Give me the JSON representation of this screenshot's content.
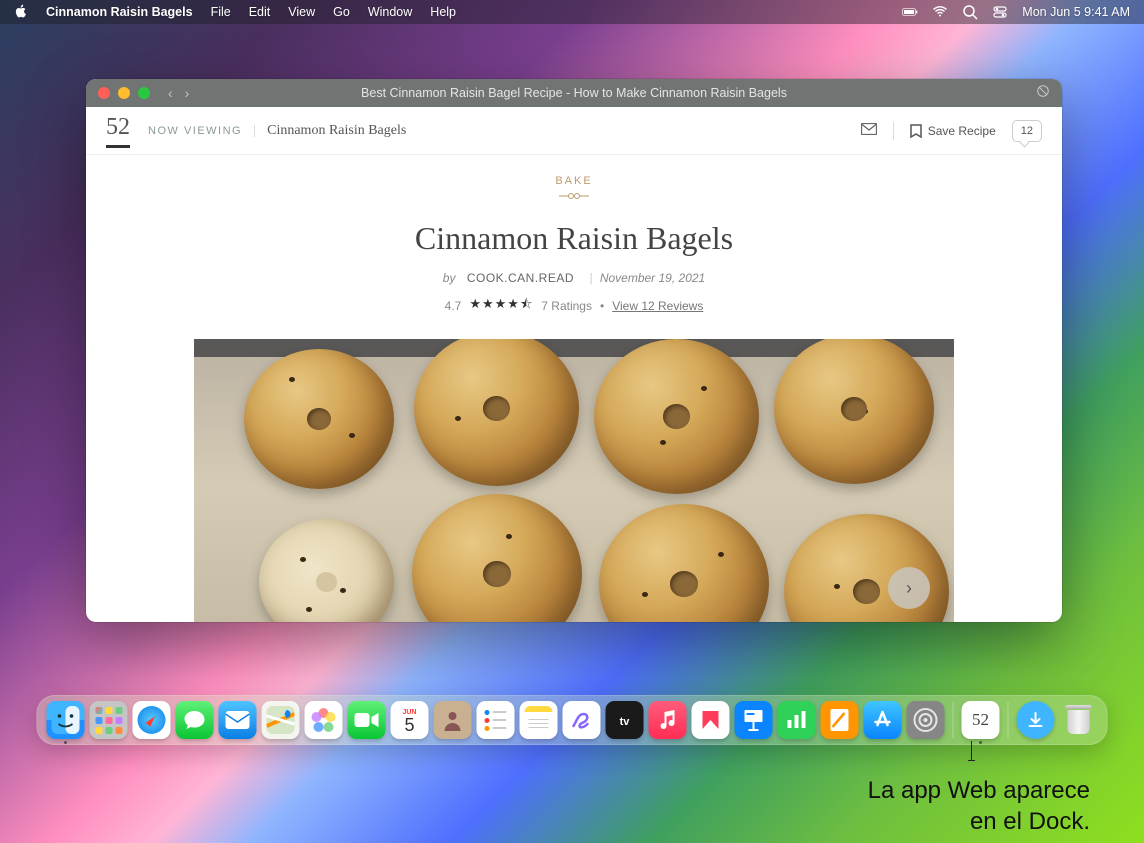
{
  "menubar": {
    "app_name": "Cinnamon Raisin Bagels",
    "items": [
      "File",
      "Edit",
      "View",
      "Go",
      "Window",
      "Help"
    ],
    "clock": "Mon Jun 5  9:41 AM"
  },
  "window": {
    "title": "Best Cinnamon Raisin Bagel Recipe - How to Make Cinnamon Raisin Bagels"
  },
  "page": {
    "site_logo": "52",
    "now_viewing": "NOW VIEWING",
    "breadcrumb": "Cinnamon Raisin Bagels",
    "save_recipe": "Save Recipe",
    "comment_count": "12",
    "category": "BAKE",
    "title": "Cinnamon Raisin Bagels",
    "by_label": "by",
    "author": "COOK.CAN.READ",
    "date": "November 19, 2021",
    "rating_value": "4.7",
    "stars": "★★★★⯪",
    "ratings_count": "7 Ratings",
    "bullet": "•",
    "reviews_link": "View 12 Reviews"
  },
  "dock": {
    "items": [
      {
        "name": "finder",
        "label": "Finder"
      },
      {
        "name": "launchpad",
        "label": "Launchpad"
      },
      {
        "name": "safari",
        "label": "Safari"
      },
      {
        "name": "messages",
        "label": "Messages"
      },
      {
        "name": "mail",
        "label": "Mail"
      },
      {
        "name": "maps",
        "label": "Maps"
      },
      {
        "name": "photos",
        "label": "Photos"
      },
      {
        "name": "facetime",
        "label": "FaceTime"
      },
      {
        "name": "calendar",
        "label": "Calendar",
        "month": "JUN",
        "day": "5"
      },
      {
        "name": "contacts",
        "label": "Contacts"
      },
      {
        "name": "reminders",
        "label": "Reminders"
      },
      {
        "name": "notes",
        "label": "Notes"
      },
      {
        "name": "freeform",
        "label": "Freeform"
      },
      {
        "name": "tv",
        "label": "TV"
      },
      {
        "name": "music",
        "label": "Music"
      },
      {
        "name": "news",
        "label": "News"
      },
      {
        "name": "keynote",
        "label": "Keynote"
      },
      {
        "name": "numbers",
        "label": "Numbers"
      },
      {
        "name": "pages",
        "label": "Pages"
      },
      {
        "name": "appstore",
        "label": "App Store"
      },
      {
        "name": "settings",
        "label": "System Settings"
      }
    ],
    "webapp_label": "52",
    "downloads": "Downloads",
    "trash": "Trash"
  },
  "caption": {
    "line1": "La app Web aparece",
    "line2": "en el Dock."
  }
}
